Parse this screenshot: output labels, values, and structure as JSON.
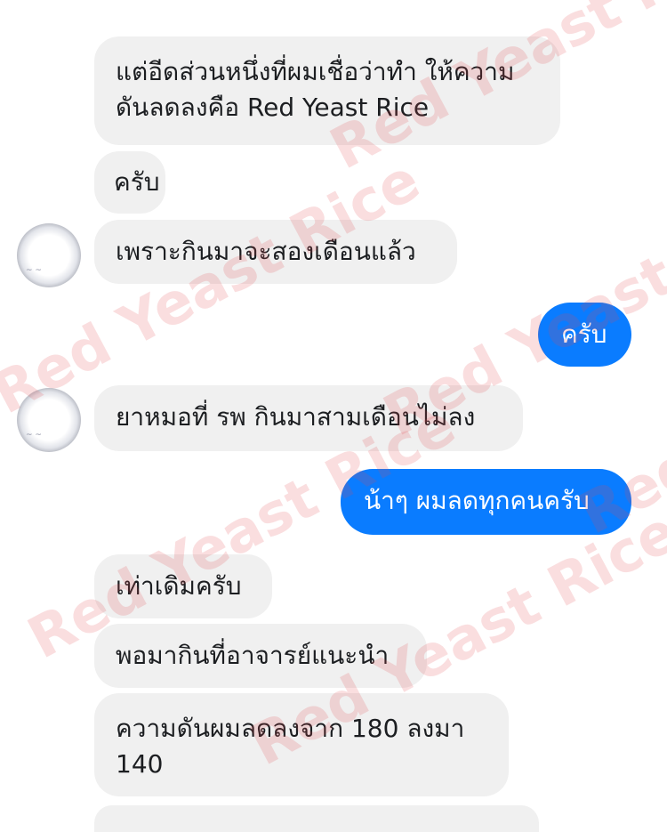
{
  "chat": {
    "messages": [
      {
        "side": "in",
        "text": "แต่อีดส่วนหนึ่งที่ผมเชื่อว่าทำ ให้ความ\nดันลดลงคือ Red Yeast Rice"
      },
      {
        "side": "in",
        "text": "ครับ"
      },
      {
        "side": "in",
        "text": "เพราะกินมาจะสองเดือนแล้ว"
      },
      {
        "side": "out",
        "text": "ครับ"
      },
      {
        "side": "in",
        "text": "ยาหมอที่ รพ กินมาสามเดือนไม่ลง"
      },
      {
        "side": "out",
        "text": "น้าๆ ผมลดทุกคนครับ"
      },
      {
        "side": "in",
        "text": "เท่าเดิมครับ"
      },
      {
        "side": "in",
        "text": "พอมากินที่อาจารย์แนะนำ"
      },
      {
        "side": "in",
        "text": "ความดันผมลดลงจาก 180 ลงมา\n140"
      }
    ]
  },
  "watermark": {
    "text": "Red Yeast Rice",
    "color": "#e24650"
  },
  "colors": {
    "incoming_bubble": "#f0f0f0",
    "outgoing_bubble": "#0a7cff"
  }
}
